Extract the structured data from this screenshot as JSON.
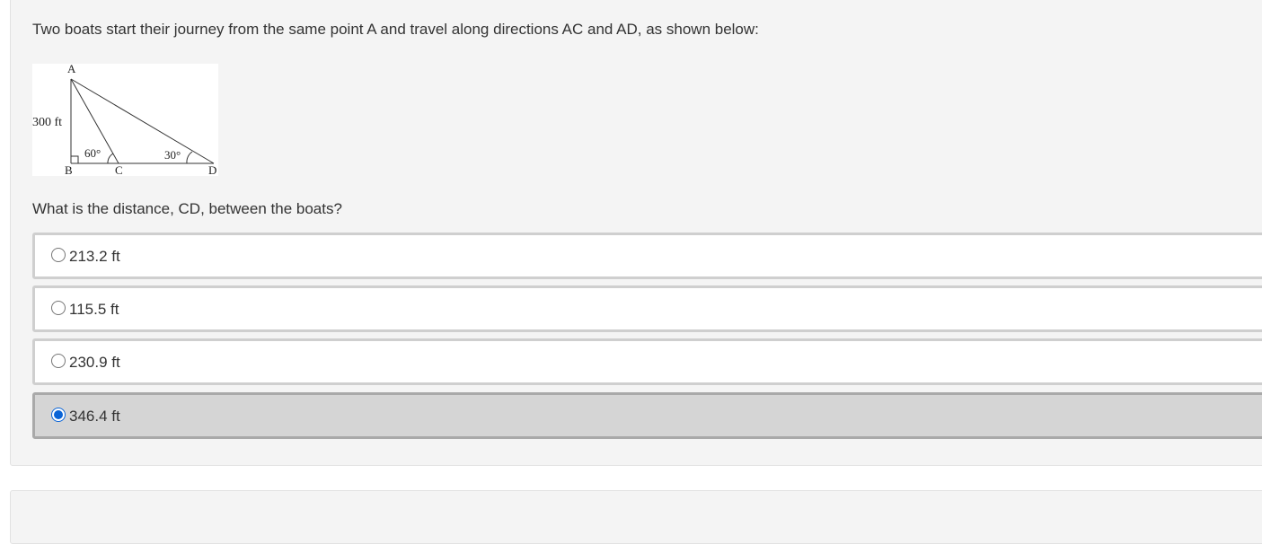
{
  "prompt": "Two boats start their journey from the same point A and travel along directions AC and AD, as shown below:",
  "figure": {
    "labels": {
      "A": "A",
      "B": "B",
      "C": "C",
      "D": "D",
      "side_ab": "300 ft",
      "angle_c": "60°",
      "angle_d": "30°"
    }
  },
  "question": "What is the distance, CD, between the boats?",
  "options": [
    {
      "label": "213.2 ft",
      "selected": false
    },
    {
      "label": "115.5 ft",
      "selected": false
    },
    {
      "label": "230.9 ft",
      "selected": false
    },
    {
      "label": "346.4 ft",
      "selected": true
    }
  ],
  "colors": {
    "card_bg": "#f4f4f4",
    "option_border": "#cfcfcf",
    "selected_bg": "#d5d5d5",
    "radio_accent": "#0a64d6"
  }
}
